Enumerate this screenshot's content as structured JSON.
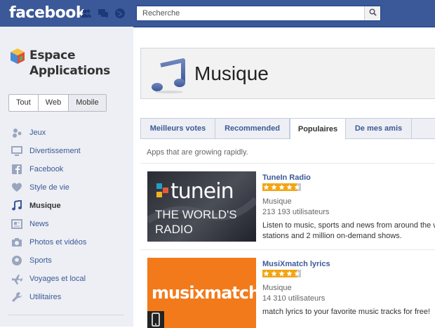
{
  "topbar": {
    "logo": "facebook",
    "search_placeholder": "Recherche"
  },
  "sidebar": {
    "title_line1": "Espace",
    "title_line2": "Applications",
    "filters": [
      {
        "label": "Tout",
        "selected": false
      },
      {
        "label": "Web",
        "selected": false
      },
      {
        "label": "Mobile",
        "selected": true
      }
    ],
    "items": [
      {
        "label": "Jeux",
        "icon": "games-icon"
      },
      {
        "label": "Divertissement",
        "icon": "monitor-icon"
      },
      {
        "label": "Facebook",
        "icon": "facebook-icon"
      },
      {
        "label": "Style de vie",
        "icon": "heart-icon"
      },
      {
        "label": "Musique",
        "icon": "music-note-icon",
        "active": true
      },
      {
        "label": "News",
        "icon": "newspaper-icon"
      },
      {
        "label": "Photos et vidéos",
        "icon": "camera-icon"
      },
      {
        "label": "Sports",
        "icon": "soccer-ball-icon"
      },
      {
        "label": "Voyages et local",
        "icon": "airplane-icon"
      },
      {
        "label": "Utilitaires",
        "icon": "wrench-icon"
      }
    ]
  },
  "main": {
    "category_title": "Musique",
    "tabs": [
      {
        "label": "Meilleurs votes"
      },
      {
        "label": "Recommended"
      },
      {
        "label": "Populaires",
        "active": true
      },
      {
        "label": "De mes amis"
      }
    ],
    "subtitle": "Apps that are growing rapidly.",
    "apps": [
      {
        "name": "TuneIn Radio",
        "rating": 4.5,
        "category": "Musique",
        "users": "213 193 utilisateurs",
        "desc_line1": "Listen to music, sports and news from around the w",
        "desc_line2": "stations and 2 million on-demand shows.",
        "thumb_brand": "tunein",
        "thumb_line1": "THE WORLD'S",
        "thumb_line2": "RADIO"
      },
      {
        "name": "MusiXmatch lyrics",
        "rating": 4.5,
        "category": "Musique",
        "users": "14 310 utilisateurs",
        "desc_line1": "match lyrics to your favorite music tracks for free!",
        "thumb_brand": "musixmatch"
      }
    ]
  },
  "colors": {
    "brand_blue": "#3b5998",
    "star": "#f2a614",
    "musix_orange": "#f27a1a"
  }
}
